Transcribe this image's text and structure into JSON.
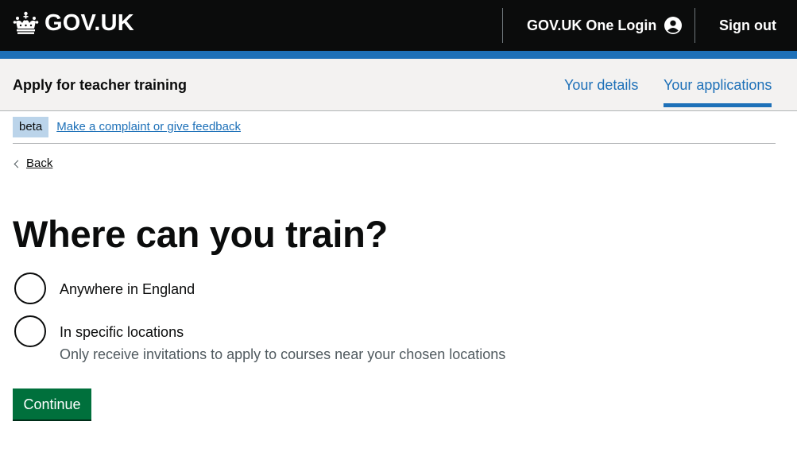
{
  "header": {
    "brand": "GOV.UK",
    "one_login": "GOV.UK One Login",
    "sign_out": "Sign out"
  },
  "service": {
    "name": "Apply for teacher training",
    "nav": [
      {
        "label": "Your details",
        "active": false
      },
      {
        "label": "Your applications",
        "active": true
      }
    ]
  },
  "phase_banner": {
    "tag": "beta",
    "link": "Make a complaint or give feedback"
  },
  "back_link": "Back",
  "page_title": "Where can you train?",
  "options": [
    {
      "label": "Anywhere in England",
      "hint": "",
      "checked": false
    },
    {
      "label": "In specific locations",
      "hint": "Only receive invitations to apply to courses near your chosen locations",
      "checked": false
    }
  ],
  "continue_label": "Continue",
  "colors": {
    "header_bg": "#0b0c0c",
    "brand_blue": "#1d70b8",
    "service_bg": "#f3f2f1",
    "button_green": "#00703c",
    "phase_tag_bg": "#bbd4ea"
  },
  "icons": [
    "crown-icon",
    "user-account-icon",
    "chevron-left-icon"
  ]
}
